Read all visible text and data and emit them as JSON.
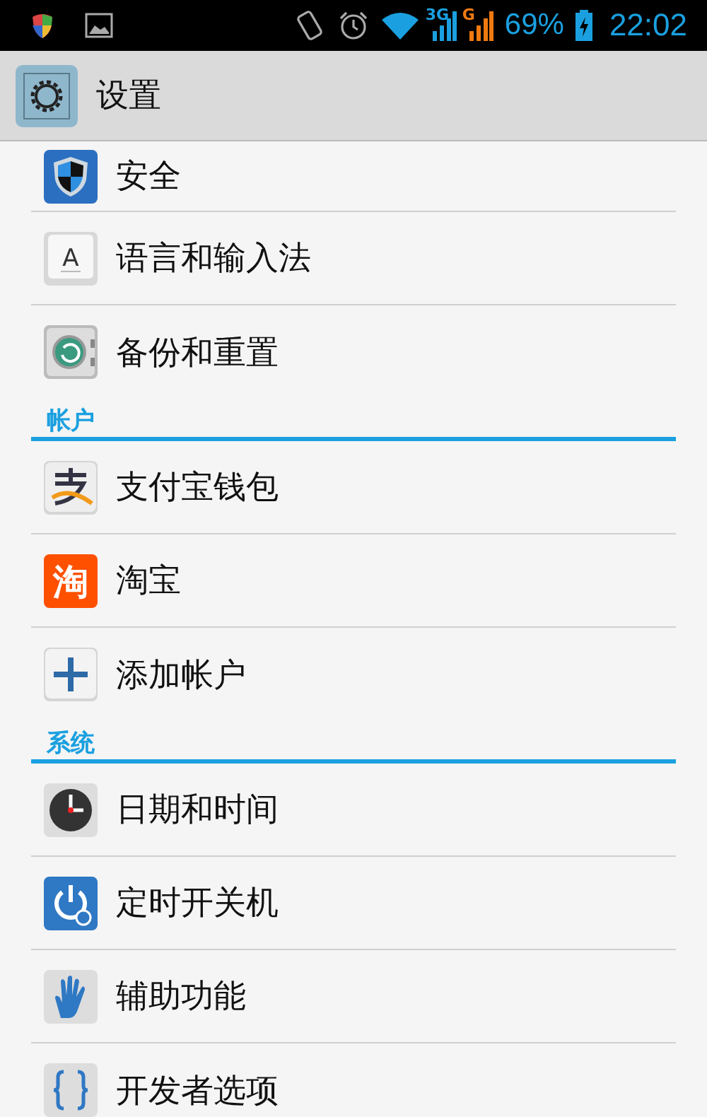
{
  "status_bar": {
    "battery": "69%",
    "time": "22:02",
    "network_3g": "3G",
    "network_g": "G"
  },
  "action_bar": {
    "title": "设置"
  },
  "list": [
    {
      "kind": "setting",
      "label": "安全"
    },
    {
      "kind": "setting",
      "label": "语言和输入法",
      "icon_text": "A"
    },
    {
      "kind": "setting",
      "label": "备份和重置"
    },
    {
      "kind": "header",
      "label": "帐户"
    },
    {
      "kind": "setting",
      "label": "支付宝钱包"
    },
    {
      "kind": "setting",
      "label": "淘宝",
      "icon_text": "淘"
    },
    {
      "kind": "setting",
      "label": "添加帐户"
    },
    {
      "kind": "header",
      "label": "系统"
    },
    {
      "kind": "setting",
      "label": "日期和时间"
    },
    {
      "kind": "setting",
      "label": "定时开关机"
    },
    {
      "kind": "setting",
      "label": "辅助功能"
    },
    {
      "kind": "setting",
      "label": "开发者选项"
    }
  ]
}
